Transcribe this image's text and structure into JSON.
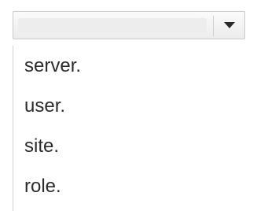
{
  "dropdown": {
    "selected_value": "",
    "arrow_icon": "caret-down-icon",
    "options": [
      {
        "label": "server."
      },
      {
        "label": "user."
      },
      {
        "label": "site."
      },
      {
        "label": "role."
      }
    ]
  }
}
